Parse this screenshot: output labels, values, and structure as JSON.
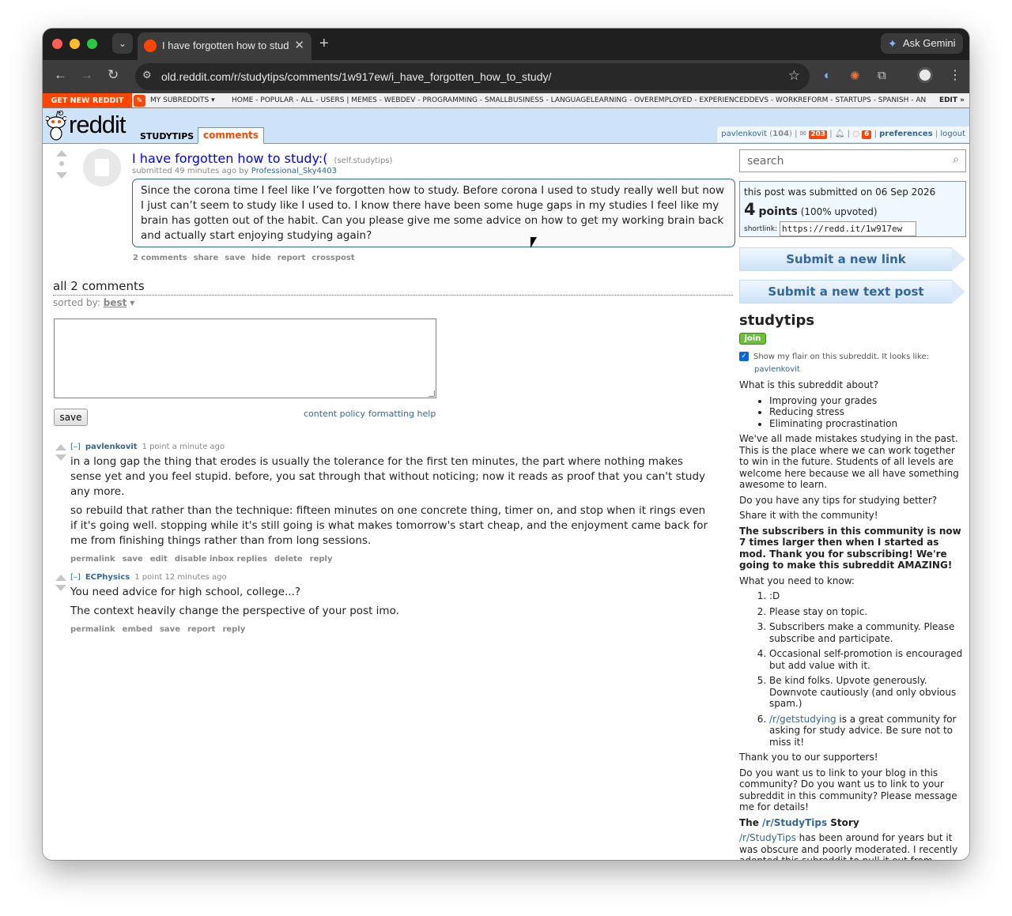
{
  "browser": {
    "tab_title": "I have forgotten how to study",
    "ask_gemini": "Ask Gemini",
    "url": "old.reddit.com/r/studytips/comments/1w917ew/i_have_forgotten_how_to_study/"
  },
  "srbar": {
    "get_new": "GET NEW REDDIT",
    "my_subreddits": "MY SUBREDDITS",
    "links": "HOME - POPULAR - ALL - USERS  |  MEMES - WEBDEV - PROGRAMMING - SMALLBUSINESS - LANGUAGELEARNING - OVEREMPLOYED - EXPERIENCEDDEVS - WORKREFORM - STARTUPS - SPANISH - AN",
    "edit": "EDIT »"
  },
  "header": {
    "logo": "reddit",
    "subreddit": "STUDYTIPS",
    "tab": "comments",
    "user": "pavlenkovit",
    "karma": "104",
    "mail_count": "203",
    "chat_count": "6",
    "preferences": "preferences",
    "logout": "logout"
  },
  "post": {
    "title": "I have forgotten how to study:(",
    "domain": "(self.studytips)",
    "submitted": "submitted 49 minutes ago by",
    "author": "Professional_Sky4403",
    "selftext": "Since the corona time I feel like I’ve forgotten how to study. Before corona I used to study really well but now I just can’t seem to study like I used to. I know there have been some huge gaps in my studies I feel like my brain has gotten out of the habit. Can you please give me some advice on how to get my working brain back and actually start enjoying studying again?",
    "buttons": [
      "2 comments",
      "share",
      "save",
      "hide",
      "report",
      "crosspost"
    ]
  },
  "comments_area": {
    "heading": "all 2 comments",
    "sorted_by": "sorted by:",
    "sort_value": "best",
    "save": "save",
    "content_policy": "content policy",
    "formatting_help": "formatting help"
  },
  "comments": [
    {
      "collapse": "[–]",
      "author": "pavlenkovit",
      "meta": "1 point a minute ago",
      "paragraphs": [
        "in a long gap the thing that erodes is usually the tolerance for the first ten minutes, the part where nothing makes sense yet and you feel stupid. before, you sat through that without noticing; now it reads as proof that you can't study any more.",
        "so rebuild that rather than the technique: fifteen minutes on one concrete thing, timer on, and stop when it rings even if it's going well. stopping while it's still going is what makes tomorrow's start cheap, and the enjoyment came back for me from finishing things rather than from long sessions."
      ],
      "buttons": [
        "permalink",
        "save",
        "edit",
        "disable inbox replies",
        "delete",
        "reply"
      ]
    },
    {
      "collapse": "[–]",
      "author": "ECPhysics",
      "meta": "1 point 12 minutes ago",
      "paragraphs": [
        "You need advice for high school, college...?",
        "The context heavily change the perspective of your post imo."
      ],
      "buttons": [
        "permalink",
        "embed",
        "save",
        "report",
        "reply"
      ]
    }
  ],
  "sidebar": {
    "search_placeholder": "search",
    "submitted_on": "this post was submitted on 06 Sep 2026",
    "points": "4",
    "points_word": "points",
    "upvoted": "(100% upvoted)",
    "shortlink_label": "shortlink:",
    "shortlink": "https://redd.it/1w917ew",
    "submit_link": "Submit a new link",
    "submit_text": "Submit a new text post",
    "subreddit": "studytips",
    "join": "join",
    "flair_text": "Show my flair on this subreddit. It looks like:",
    "flair_user": "pavlenkovit",
    "about_q": "What is this subreddit about?",
    "about_items": [
      "Improving your grades",
      "Reducing stress",
      "Eliminating procrastination"
    ],
    "about_p": "We've all made mistakes studying in the past. This is the place where we can work together to win in the future. Students of all levels are welcome here because we all have something awesome to learn.",
    "tips_q": "Do you have any tips for studying better?",
    "share": "Share it with the community!",
    "bold_note": "The subscribers in this community is now 7 times larger then when I started as mod. Thank you for subscribing! We're going to make this subreddit AMAZING!",
    "know": "What you need to know:",
    "rules": [
      ":D",
      "Please stay on topic.",
      "Subscribers make a community. Please subscribe and participate.",
      "Occasional self-promotion is encouraged but add value with it.",
      "Be kind folks. Upvote generously. Downvote cautiously (and only obvious spam.)"
    ],
    "rule6_link": "/r/getstudying",
    "rule6_text": " is a great community for asking for study advice. Be sure not to miss it!",
    "thanks": "Thank you to our supporters!",
    "blog": "Do you want us to link to your blog in this community? Do you want us to link to your subreddit in this community? Please message me for details!",
    "story_pre": "The ",
    "story_link": "/r/StudyTips",
    "story_post": " Story",
    "story_p_link": "/r/StudyTips",
    "story_p": " has been around for years but it was obscure and poorly moderated. I recently adopted this subreddit to pull it out from"
  }
}
